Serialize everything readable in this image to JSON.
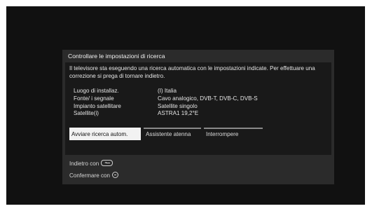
{
  "dialog": {
    "title": "Controllare le impostazioni di ricerca",
    "message": "Il televisore sta eseguendo una ricerca automatica con le impostazioni indicate. Per effettuare una correzione si prega di tornare indietro.",
    "settings": [
      {
        "label": "Luogo di installaz.",
        "value": "(I) Italia"
      },
      {
        "label": "Fonte/ i segnale",
        "value": "Cavo analogico, DVB-T, DVB-C, DVB-S"
      },
      {
        "label": "Impianto satellitare",
        "value": "Satellite singolo"
      },
      {
        "label": "Satellite(i)",
        "value": "ASTRA1 19,2°E"
      }
    ],
    "buttons": {
      "start": "Avviare ricerca autom.",
      "assistant": "Assistente atenna",
      "cancel": "Interrompere"
    }
  },
  "hints": {
    "back_label": "Indietro con",
    "back_icon": "back-button-icon",
    "confirm_label": "Confermare con",
    "confirm_icon": "ok-button-icon"
  }
}
